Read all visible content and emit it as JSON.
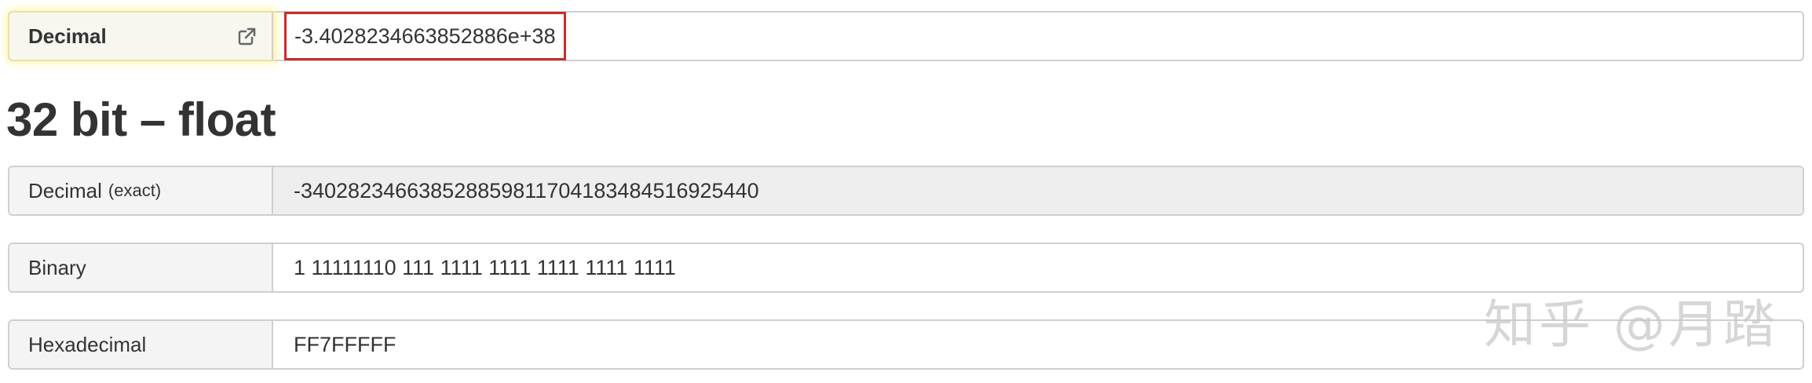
{
  "input_row": {
    "label": "Decimal",
    "value": "-3.4028234663852886e+38",
    "link_icon": "external-link-icon"
  },
  "section": {
    "title": "32 bit – float"
  },
  "rows": {
    "decimal_exact": {
      "label": "Decimal",
      "label_suffix": "(exact)",
      "value": "-340282346638528859811704183484516925440"
    },
    "binary": {
      "label": "Binary",
      "value": "1 11111110 111 1111 1111 1111 1111 1111"
    },
    "hexadecimal": {
      "label": "Hexadecimal",
      "value": "FF7FFFFF"
    }
  },
  "watermark": {
    "text": "知乎 @月踏"
  },
  "colors": {
    "highlight_border": "#cc2b2b",
    "addon_bg": "#f4f4f4",
    "readonly_bg": "#eeeeee",
    "glow": "#fff082"
  }
}
